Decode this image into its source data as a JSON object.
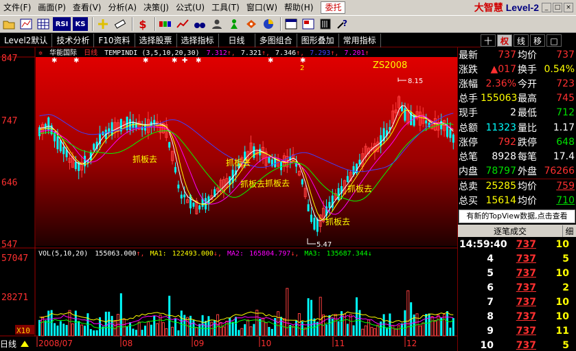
{
  "menubar": {
    "items": [
      "文件(F)",
      "画面(P)",
      "查看(V)",
      "分析(A)",
      "决策(J)",
      "公式(U)",
      "工具(T)",
      "窗口(W)",
      "帮助(H)"
    ],
    "entrust": "委托",
    "brand": "大智慧",
    "brand_level": "Level-2",
    "win_buttons": [
      "_",
      "□",
      "×"
    ]
  },
  "toolbar": {
    "icons": [
      "folder-icon",
      "bar-chart-icon",
      "grid-icon",
      "rsi-icon",
      "ks-icon",
      "cross-icon",
      "ruler-icon",
      "dollar-icon",
      "boxes-icon",
      "trend-icon",
      "binoculars-icon",
      "user-icon",
      "green-figure-icon",
      "eye-icon",
      "pie-icon",
      "window-icon",
      "doc-icon",
      "book-icon",
      "help-icon"
    ],
    "rsi_label": "RSI",
    "ks_label": "KS"
  },
  "tabs": [
    "Level2默认",
    "技术分析",
    "F10资料",
    "选择股票",
    "选择指标",
    "日线",
    "多图组合",
    "图形叠加",
    "常用指标"
  ],
  "panel_buttons": [
    "十",
    "权",
    "线",
    "移",
    "□"
  ],
  "chart": {
    "stock_name": "华能国际",
    "period": "日线",
    "indicator": "TEMPINDI",
    "indicator_params": "(3,5,10,20,30)",
    "ma_values": [
      "7.312",
      "7.321",
      "7.346",
      "7.293",
      "7.201"
    ],
    "price_axis": [
      "847",
      "747",
      "646",
      "547"
    ],
    "vol_axis": [
      "57047",
      "28271"
    ],
    "vol_scale": "X10",
    "high_label": "8.15",
    "low_label": "5.47",
    "watermark": "ZS2008",
    "annotation": "抓板去",
    "marker_2": "2",
    "vol_legend": {
      "name": "VOL(5,10,20)",
      "vol": "155063.000",
      "ma1_label": "MA1:",
      "ma1": "122493.000",
      "ma2_label": "MA2:",
      "ma2": "165804.797",
      "ma3_label": "MA3:",
      "ma3": "135687.344"
    },
    "date_labels": [
      "2008/07",
      "08",
      "09",
      "10",
      "11",
      "12"
    ],
    "bottom_tab": "日线",
    "colors": {
      "up": "#ff4040",
      "down": "#00ffff",
      "ma3": "#ffffff",
      "ma5": "#ffff00",
      "ma10": "#ff00ff",
      "ma20": "#00ff00",
      "ma30": "#4040ff"
    }
  },
  "chart_data": {
    "type": "candlestick",
    "y_range": [
      5.47,
      8.47
    ],
    "high": 8.15,
    "low": 5.47,
    "series_ma": [
      "MA3",
      "MA5",
      "MA10",
      "MA20",
      "MA30"
    ]
  },
  "quote": {
    "rows": [
      {
        "l1": "最新",
        "v1": "737",
        "c1": "red",
        "l2": "均价",
        "v2": "737",
        "c2": "red"
      },
      {
        "l1": "涨跌",
        "v1": "▲017",
        "c1": "red",
        "l2": "换手",
        "v2": "0.54%",
        "c2": "yellow"
      },
      {
        "l1": "涨幅",
        "v1": "2.36%",
        "c1": "red",
        "l2": "今开",
        "v2": "723",
        "c2": "red"
      },
      {
        "l1": "总手",
        "v1": "155063",
        "c1": "yellow",
        "l2": "最高",
        "v2": "745",
        "c2": "red"
      },
      {
        "l1": "现手",
        "v1": "2",
        "c1": "white",
        "l2": "最低",
        "v2": "712",
        "c2": "green"
      },
      {
        "l1": "总额",
        "v1": "11323",
        "c1": "cyan",
        "l2": "量比",
        "v2": "1.17",
        "c2": "white"
      },
      {
        "l1": "涨停",
        "v1": "792",
        "c1": "red",
        "l2": "跌停",
        "v2": "648",
        "c2": "green"
      },
      {
        "l1": "总笔",
        "v1": "8928",
        "c1": "white",
        "l2": "每笔",
        "v2": "17.4",
        "c2": "white"
      },
      {
        "l1": "内盘",
        "v1": "78797",
        "c1": "green",
        "l2": "外盘",
        "v2": "76266",
        "c2": "red"
      }
    ],
    "buy_sell": [
      {
        "l1": "总卖",
        "v1": "25285",
        "c1": "yellow",
        "l2": "均价",
        "v2": "759",
        "c2": "red"
      },
      {
        "l1": "总买",
        "v1": "15614",
        "c1": "yellow",
        "l2": "均价",
        "v2": "710",
        "c2": "green"
      }
    ],
    "topview_button": "有新的TopView数据,点击查看",
    "tick_header": "逐笔成交",
    "tick_header_btn": "细",
    "ticks": [
      {
        "t": "14:59:40",
        "p": "737",
        "v": "10"
      },
      {
        "t": "4",
        "p": "737",
        "v": "5"
      },
      {
        "t": "5",
        "p": "737",
        "v": "10"
      },
      {
        "t": "6",
        "p": "737",
        "v": "2"
      },
      {
        "t": "7",
        "p": "737",
        "v": "10"
      },
      {
        "t": "8",
        "p": "737",
        "v": "10"
      },
      {
        "t": "9",
        "p": "737",
        "v": "11"
      },
      {
        "t": "10",
        "p": "737",
        "v": "5"
      }
    ]
  }
}
